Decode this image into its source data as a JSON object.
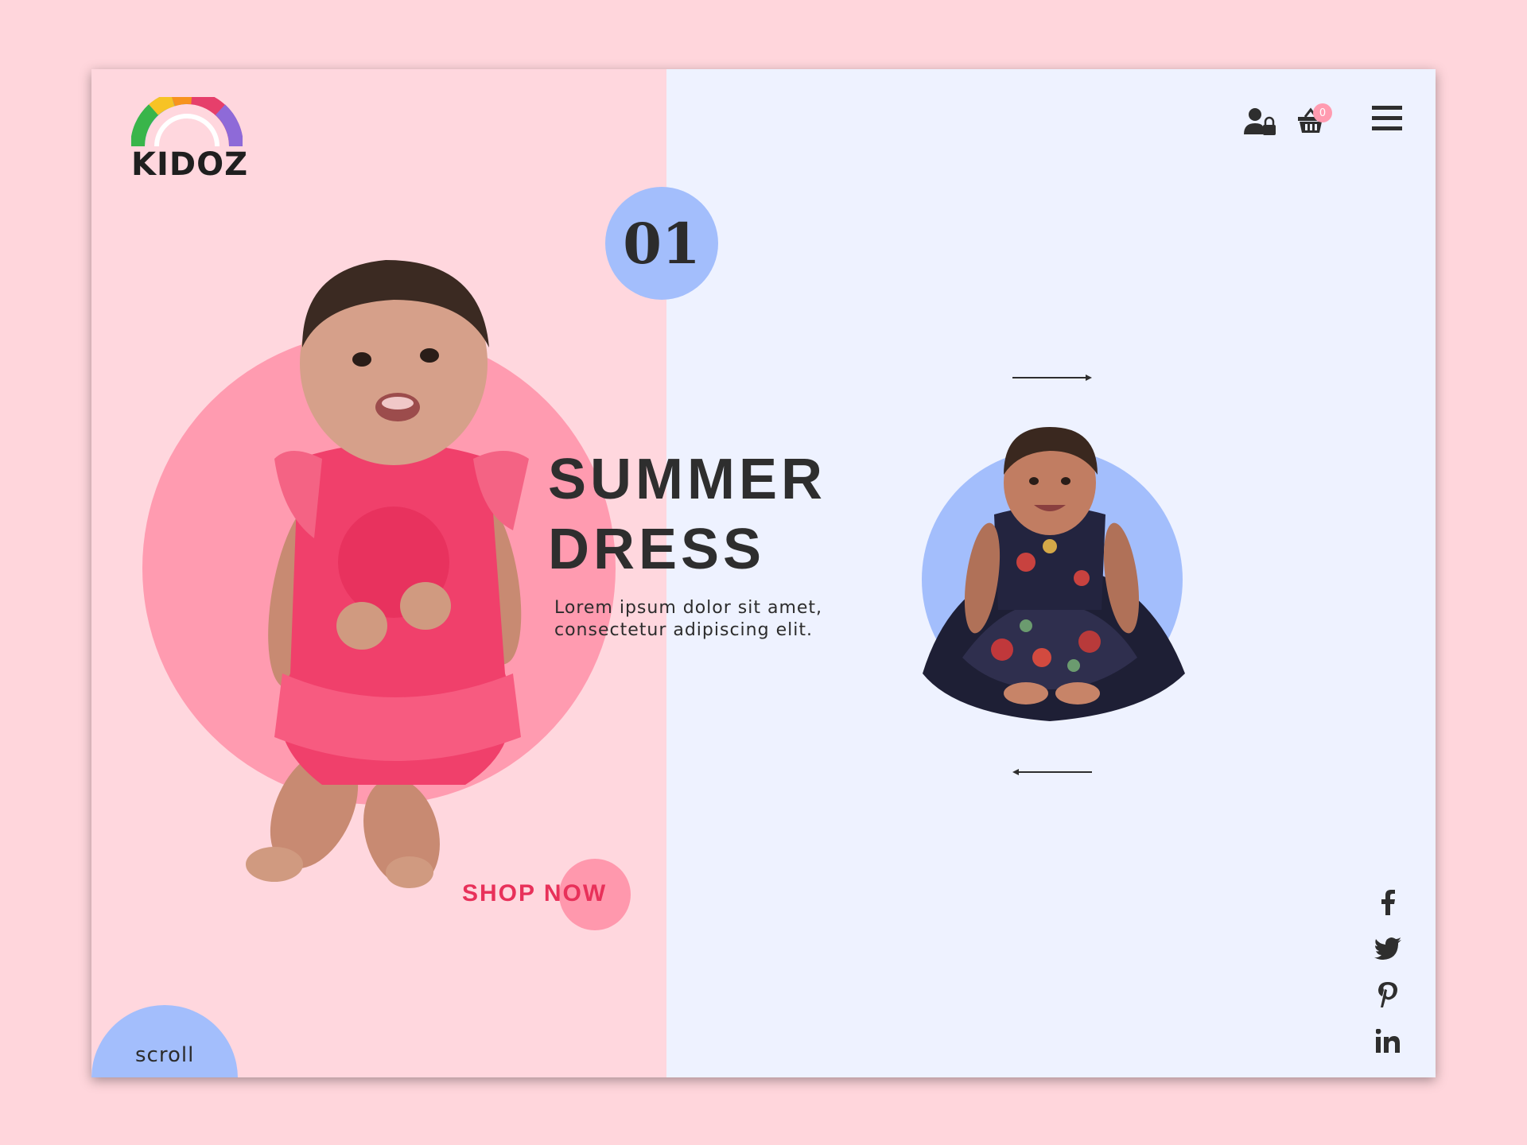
{
  "brand": {
    "name": "KIDOZ"
  },
  "hero": {
    "slide_number": "01",
    "title": "SUMMER\nDRESS",
    "subtitle": "Lorem ipsum dolor sit amet, consectetur adipiscing elit.",
    "cta_label": "SHOP NOW"
  },
  "header": {
    "cart_count": "0"
  },
  "footer": {
    "scroll_label": "scroll"
  },
  "icons": {
    "account": "user-lock-icon",
    "cart": "basket-icon",
    "menu": "hamburger-menu-icon",
    "next": "arrow-right-icon",
    "prev": "arrow-left-icon",
    "social": [
      "facebook-icon",
      "twitter-icon",
      "pinterest-icon",
      "linkedin-icon"
    ]
  },
  "colors": {
    "page_bg": "#ffd6dc",
    "left_panel": "#ffd7de",
    "right_panel": "#eef2ff",
    "accent_blue": "#a3befc",
    "accent_pink": "#ff9bb0",
    "cta": "#e8315a",
    "text_dark": "#2e2e2e"
  }
}
